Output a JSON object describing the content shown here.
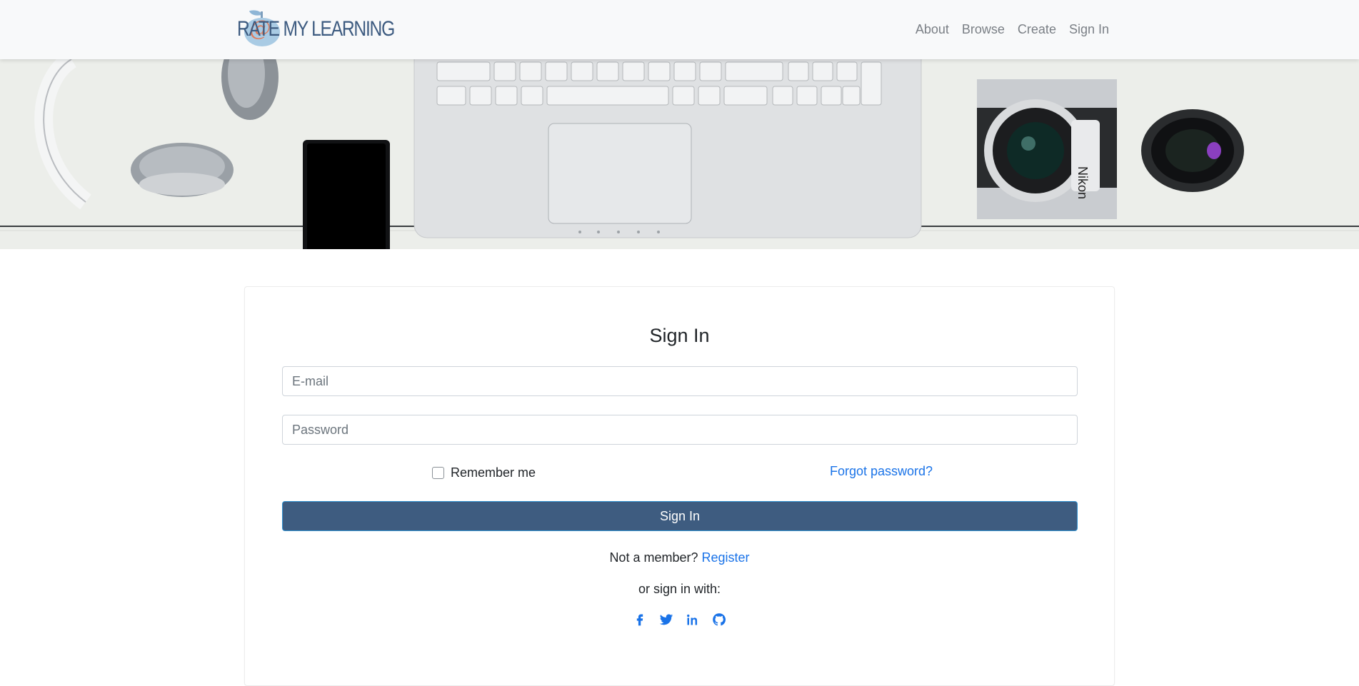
{
  "brand": {
    "at_symbol": "@",
    "name": "RATE MY LEARNING"
  },
  "nav": {
    "items": [
      "About",
      "Browse",
      "Create",
      "Sign In"
    ]
  },
  "hero": {
    "camera_brand": "Nikon"
  },
  "form": {
    "title": "Sign In",
    "email_placeholder": "E-mail",
    "password_placeholder": "Password",
    "remember_label": "Remember me",
    "forgot_label": "Forgot password?",
    "submit_label": "Sign In",
    "not_member_text": "Not a member?",
    "register_label": "Register",
    "or_sign_in_with": "or sign in with:"
  },
  "social": {
    "icons": [
      "facebook-icon",
      "twitter-icon",
      "linkedin-icon",
      "github-icon"
    ]
  },
  "colors": {
    "nav_bg": "#f8f9fa",
    "button_bg": "#3e5c80",
    "link": "#1a73e8",
    "brand_text": "#3d5b80"
  }
}
